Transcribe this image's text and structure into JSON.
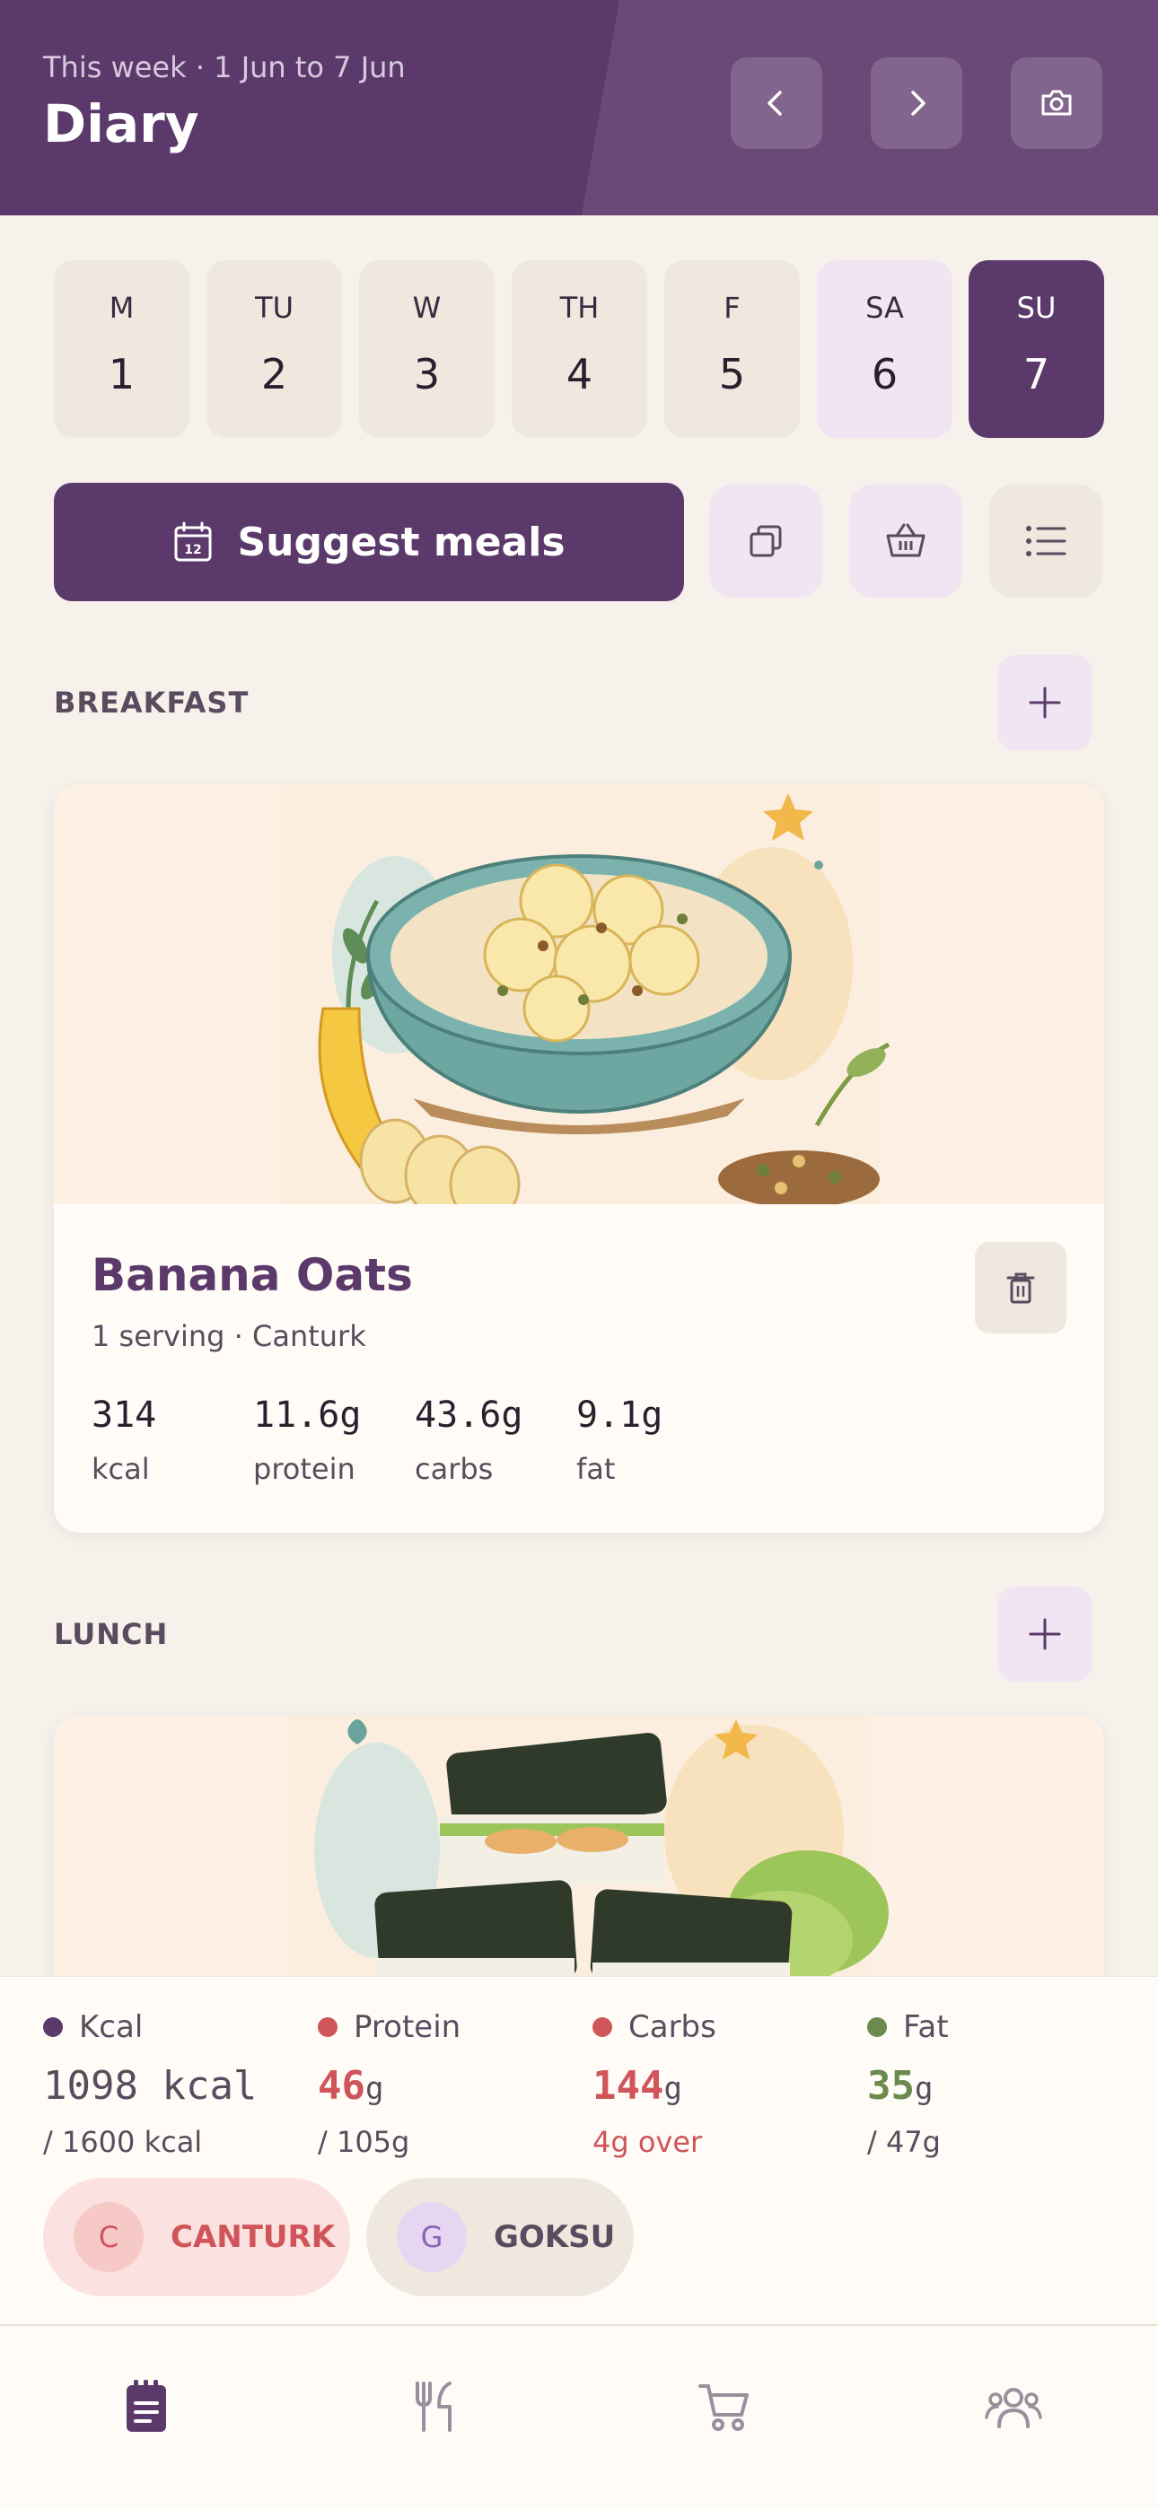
{
  "header": {
    "week_label": "This week · 1 Jun to 7 Jun",
    "title": "Diary",
    "prev_icon": "chevron-left-icon",
    "next_icon": "chevron-right-icon",
    "camera_icon": "camera-icon"
  },
  "days": [
    {
      "label": "M",
      "num": "1",
      "state": "normal"
    },
    {
      "label": "TU",
      "num": "2",
      "state": "normal"
    },
    {
      "label": "W",
      "num": "3",
      "state": "normal"
    },
    {
      "label": "TH",
      "num": "4",
      "state": "normal"
    },
    {
      "label": "F",
      "num": "5",
      "state": "normal"
    },
    {
      "label": "SA",
      "num": "6",
      "state": "weekend"
    },
    {
      "label": "SU",
      "num": "7",
      "state": "active"
    }
  ],
  "actions": {
    "suggest_label": "Suggest meals",
    "calendar_icon_day": "12",
    "copy_icon": "copy-icon",
    "basket_icon": "basket-icon",
    "list_icon": "list-icon"
  },
  "sections": {
    "breakfast": "BREAKFAST",
    "lunch": "LUNCH"
  },
  "breakfast_meal": {
    "name": "Banana Oats",
    "subtitle": "1 serving · Canturk",
    "macros": [
      {
        "value": "314",
        "label": "kcal"
      },
      {
        "value": "11.6g",
        "label": "protein"
      },
      {
        "value": "43.6g",
        "label": "carbs"
      },
      {
        "value": "9.1g",
        "label": "fat"
      }
    ]
  },
  "summary": {
    "kcal": {
      "label": "Kcal",
      "value": "1098",
      "unit": " kcal",
      "sub": "/ 1600 kcal",
      "color": "#5b3a6b"
    },
    "protein": {
      "label": "Protein",
      "value": "46",
      "unit": "g",
      "sub": "/ 105g",
      "color": "#d0555a"
    },
    "carbs": {
      "label": "Carbs",
      "value": "144",
      "unit": "g",
      "sub": "4g over",
      "color": "#d0555a"
    },
    "fat": {
      "label": "Fat",
      "value": "35",
      "unit": "g",
      "sub": "/ 47g",
      "color": "#6b8a4e"
    }
  },
  "users": [
    {
      "initial": "C",
      "name": "CANTURK",
      "active": true
    },
    {
      "initial": "G",
      "name": "GOKSU",
      "active": false
    }
  ],
  "nav": [
    "diary-icon",
    "recipes-icon",
    "cart-icon",
    "household-icon"
  ],
  "colors": {
    "primary": "#5b3a6b",
    "background": "#f6f1ea",
    "accent_soft": "#f1e5f3",
    "warning": "#d0555a"
  }
}
